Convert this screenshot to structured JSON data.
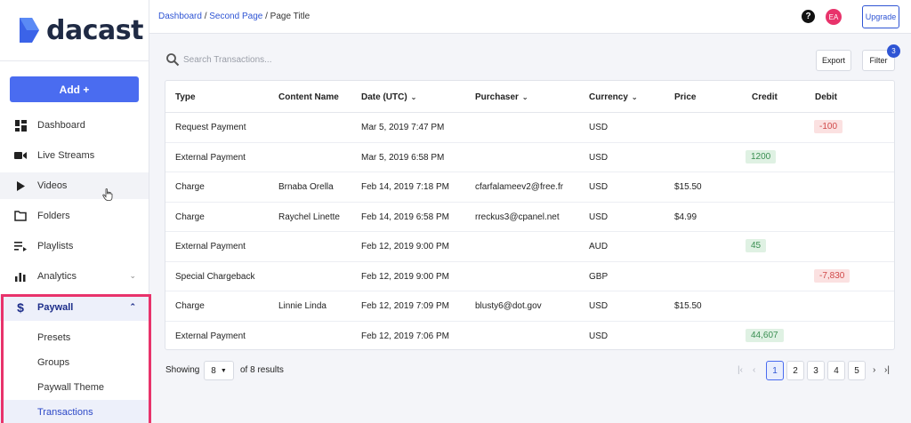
{
  "brand": {
    "name": "dacast",
    "accent": "#4a6cf0"
  },
  "sidebar": {
    "add_label": "Add +",
    "items": [
      {
        "label": "Dashboard",
        "icon": "dashboard-icon"
      },
      {
        "label": "Live Streams",
        "icon": "video-camera-icon"
      },
      {
        "label": "Videos",
        "icon": "play-icon"
      },
      {
        "label": "Folders",
        "icon": "folder-icon"
      },
      {
        "label": "Playlists",
        "icon": "playlist-icon"
      },
      {
        "label": "Analytics",
        "icon": "bar-chart-icon"
      },
      {
        "label": "Paywall",
        "icon": "dollar-icon"
      }
    ],
    "paywall_sub": [
      "Presets",
      "Groups",
      "Paywall Theme",
      "Transactions"
    ]
  },
  "header": {
    "breadcrumb": {
      "first": "Dashboard",
      "second": "Second Page",
      "current": "Page Title",
      "sep": "/"
    },
    "help": "?",
    "avatar_initials": "EA",
    "upgrade_label": "Upgrade"
  },
  "toolbar": {
    "search_placeholder": "Search Transactions...",
    "export_label": "Export",
    "filter_label": "Filter",
    "filter_count": "3"
  },
  "table": {
    "columns": [
      "Type",
      "Content Name",
      "Date (UTC)",
      "Purchaser",
      "Currency",
      "Price",
      "Credit",
      "Debit"
    ],
    "rows": [
      {
        "type": "Request Payment",
        "content": "",
        "date": "Mar 5, 2019 7:47 PM",
        "purchaser": "",
        "currency": "USD",
        "price": "",
        "credit": "",
        "debit": "-100"
      },
      {
        "type": "External Payment",
        "content": "",
        "date": "Mar 5, 2019 6:58 PM",
        "purchaser": "",
        "currency": "USD",
        "price": "",
        "credit": "1200",
        "debit": ""
      },
      {
        "type": "Charge",
        "content": "Brnaba Orella",
        "date": "Feb 14, 2019 7:18 PM",
        "purchaser": "cfarfalameev2@free.fr",
        "currency": "USD",
        "price": "$15.50",
        "credit": "",
        "debit": ""
      },
      {
        "type": "Charge",
        "content": "Raychel Linette",
        "date": "Feb 14, 2019 6:58 PM",
        "purchaser": "rreckus3@cpanel.net",
        "currency": "USD",
        "price": "$4.99",
        "credit": "",
        "debit": ""
      },
      {
        "type": "External Payment",
        "content": "",
        "date": "Feb 12, 2019 9:00 PM",
        "purchaser": "",
        "currency": "AUD",
        "price": "",
        "credit": "45",
        "debit": ""
      },
      {
        "type": "Special Chargeback",
        "content": "",
        "date": "Feb 12, 2019 9:00 PM",
        "purchaser": "",
        "currency": "GBP",
        "price": "",
        "credit": "",
        "debit": "-7,830"
      },
      {
        "type": "Charge",
        "content": "Linnie Linda",
        "date": "Feb 12, 2019 7:09 PM",
        "purchaser": "blusty6@dot.gov",
        "currency": "USD",
        "price": "$15.50",
        "credit": "",
        "debit": ""
      },
      {
        "type": "External Payment",
        "content": "",
        "date": "Feb 12, 2019 7:06 PM",
        "purchaser": "",
        "currency": "USD",
        "price": "",
        "credit": "44,607",
        "debit": ""
      }
    ]
  },
  "footer": {
    "showing_label": "Showing",
    "per_page": "8",
    "results_label": "of 8 results",
    "pages": [
      "1",
      "2",
      "3",
      "4",
      "5"
    ],
    "active_page": "1",
    "first": "|‹",
    "prev": "‹",
    "next": "›",
    "last": "›|"
  }
}
